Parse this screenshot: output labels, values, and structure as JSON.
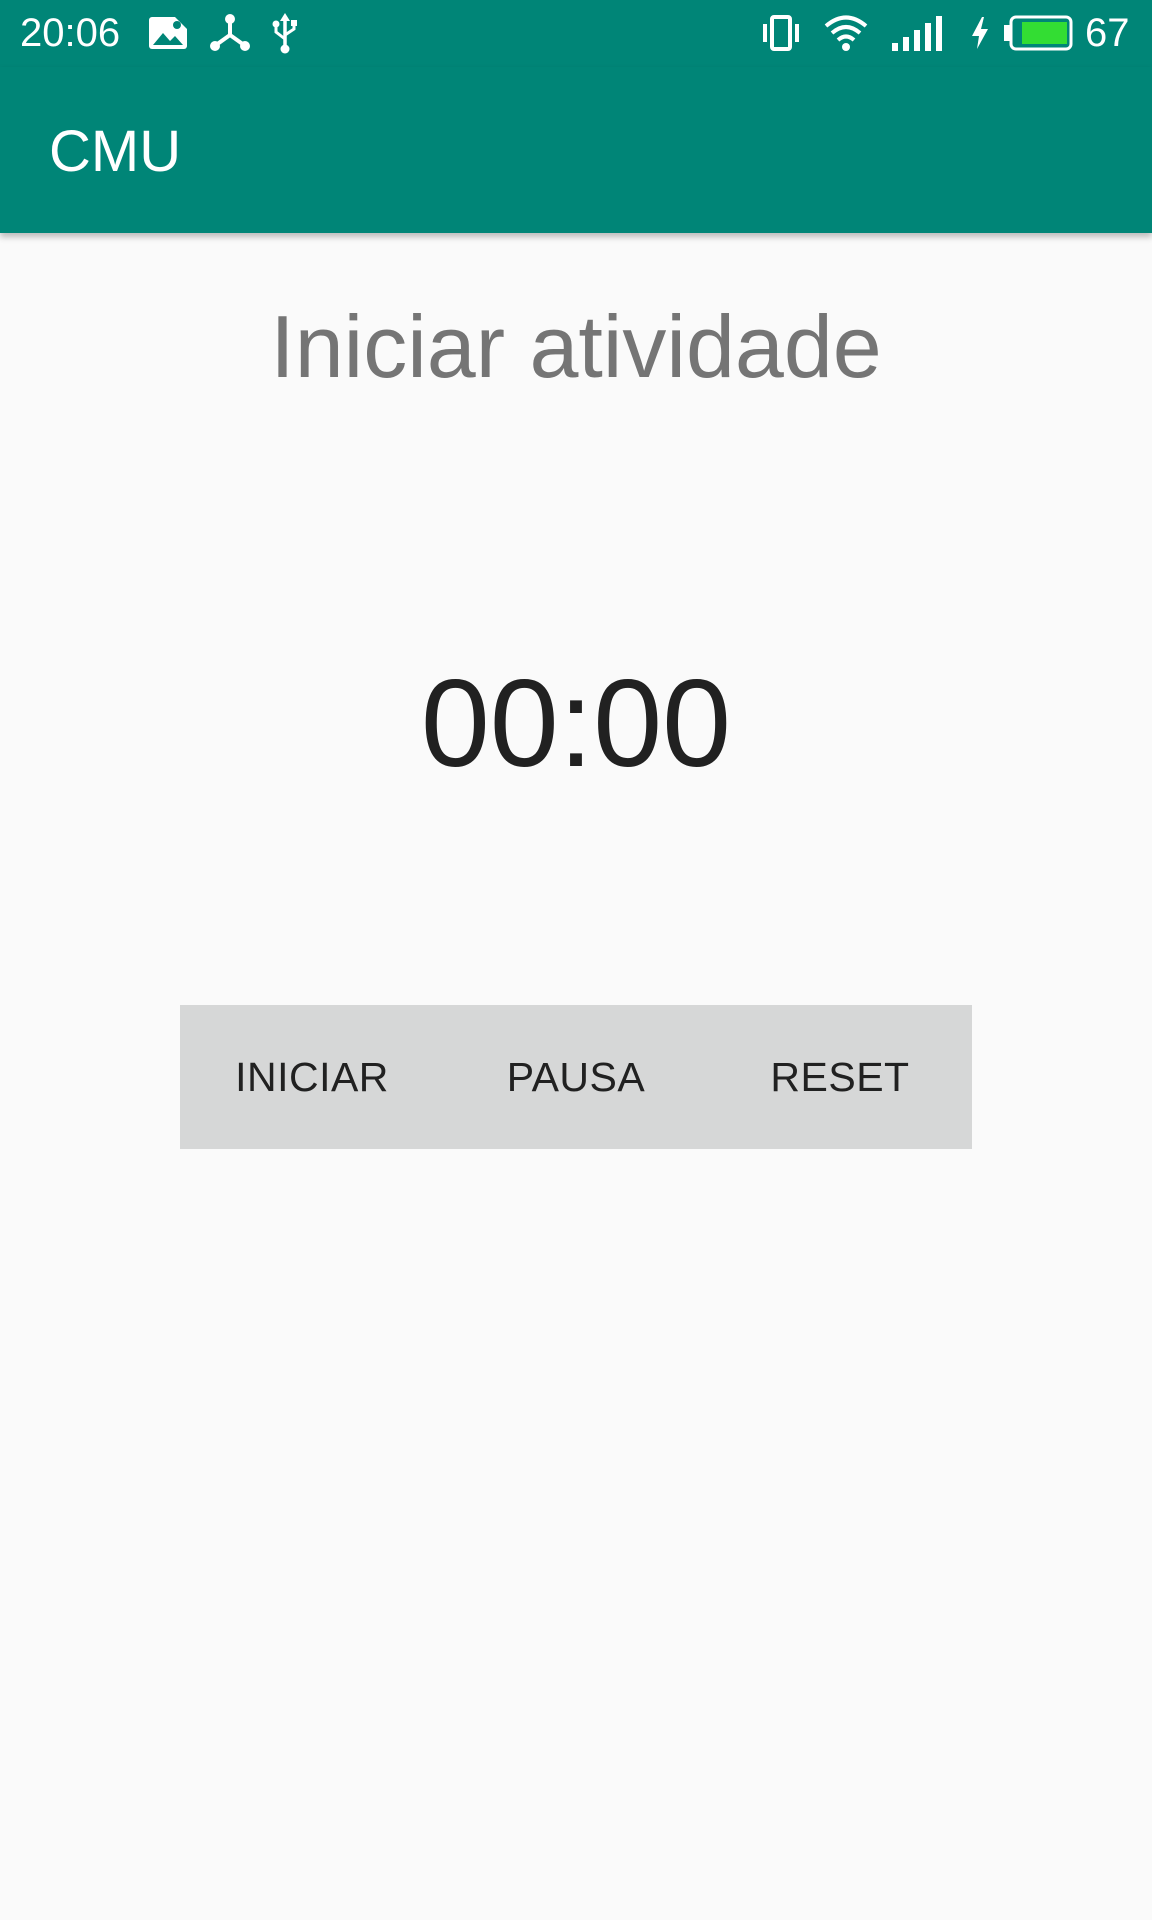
{
  "status_bar": {
    "time": "20:06",
    "battery_level": "67",
    "icons": [
      "gallery-notification-icon",
      "share-notification-icon",
      "usb-icon",
      "vibrate-icon",
      "wifi-icon",
      "signal-icon",
      "charging-icon",
      "battery-icon"
    ],
    "background_color": "#008577",
    "battery_color": "#33dd33"
  },
  "app_bar": {
    "title": "CMU"
  },
  "main": {
    "activity_title": "Iniciar atividade",
    "timer": "00:00",
    "buttons": {
      "start_label": "INICIAR",
      "pause_label": "PAUSA",
      "reset_label": "RESET"
    }
  }
}
